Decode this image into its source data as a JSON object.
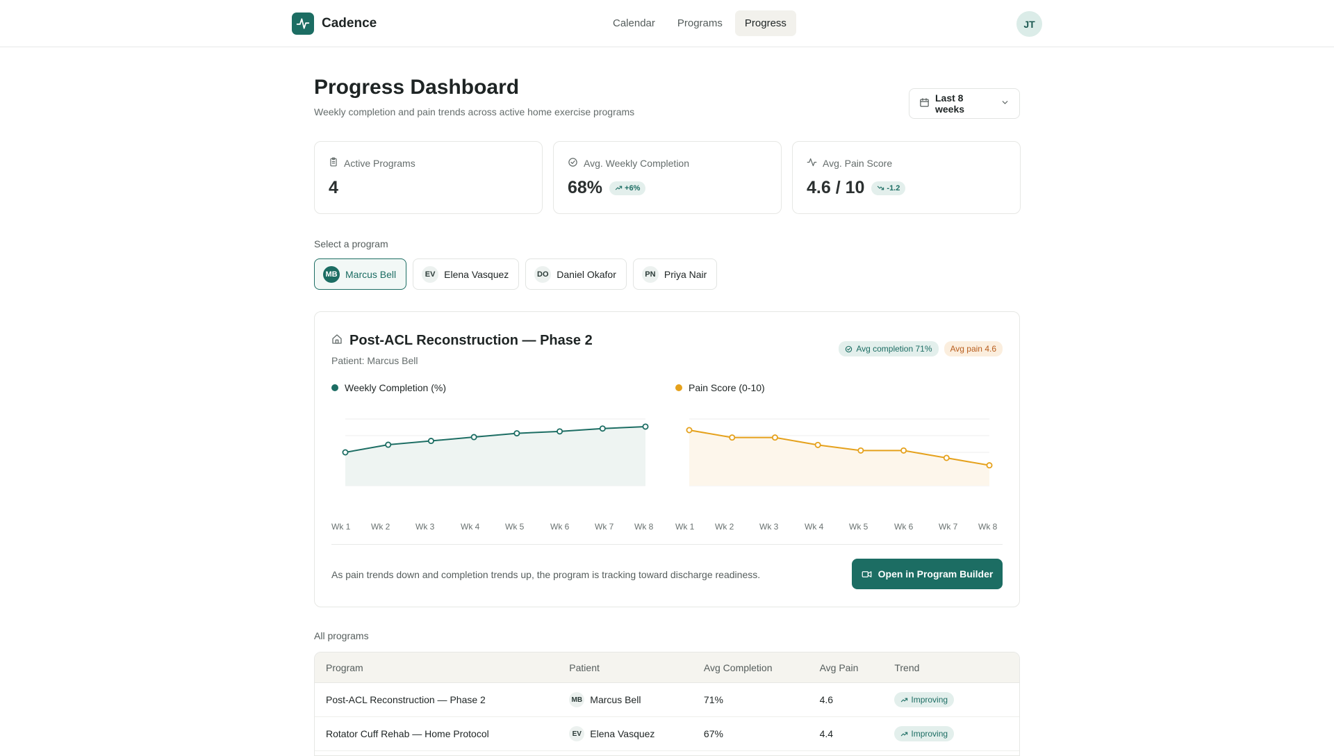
{
  "app": {
    "name": "Cadence",
    "user_initials": "JT"
  },
  "nav": {
    "items": [
      {
        "label": "Calendar"
      },
      {
        "label": "Programs"
      },
      {
        "label": "Progress"
      }
    ],
    "active_index": 2
  },
  "header": {
    "title": "Progress Dashboard",
    "subtitle": "Weekly completion and pain trends across active home exercise programs",
    "range": "Last 8 weeks"
  },
  "stats": [
    {
      "label": "Active Programs",
      "value": "4",
      "icon": "clipboard-icon"
    },
    {
      "label": "Avg. Weekly Completion",
      "value": "68%",
      "delta": "+6%",
      "icon": "check-circle-icon"
    },
    {
      "label": "Avg. Pain Score",
      "value": "4.6 / 10",
      "delta": "-1.2",
      "icon": "activity-icon"
    }
  ],
  "selector": {
    "label": "Select a program",
    "programs": [
      {
        "initials": "MB",
        "name": "Marcus Bell"
      },
      {
        "initials": "EV",
        "name": "Elena Vasquez"
      },
      {
        "initials": "DO",
        "name": "Daniel Okafor"
      },
      {
        "initials": "PN",
        "name": "Priya Nair"
      }
    ],
    "active_index": 0
  },
  "detail": {
    "title": "Post-ACL Reconstruction — Phase 2",
    "patient": "Patient: Marcus Bell",
    "avg_completion_pill": "Avg completion 71%",
    "avg_pain_pill": "Avg pain 4.6",
    "insight": "As pain trends down and completion trends up, the program is tracking toward discharge readiness.",
    "button": "Open in Program Builder"
  },
  "colors": {
    "accent": "#1c6d63",
    "pain": "#e5a11c"
  },
  "chart_data": [
    {
      "type": "area",
      "title": "Weekly Completion (%)",
      "categories": [
        "Wk 1",
        "Wk 2",
        "Wk 3",
        "Wk 4",
        "Wk 5",
        "Wk 6",
        "Wk 7",
        "Wk 8"
      ],
      "values": [
        55,
        63,
        67,
        71,
        75,
        77,
        80,
        82
      ],
      "ylim": [
        0,
        100
      ],
      "color": "#1c6d63",
      "grid": true
    },
    {
      "type": "area",
      "title": "Pain Score (0-10)",
      "categories": [
        "Wk 1",
        "Wk 2",
        "Wk 3",
        "Wk 4",
        "Wk 5",
        "Wk 6",
        "Wk 7",
        "Wk 8"
      ],
      "values": [
        5.9,
        5.5,
        5.5,
        5.1,
        4.8,
        4.8,
        4.4,
        4.0
      ],
      "ylim": [
        0,
        10
      ],
      "color": "#e5a11c",
      "grid": true
    }
  ],
  "table": {
    "section_label": "All programs",
    "columns": [
      "Program",
      "Patient",
      "Avg Completion",
      "Avg Pain",
      "Trend"
    ],
    "rows": [
      {
        "program": "Post-ACL Reconstruction — Phase 2",
        "initials": "MB",
        "patient": "Marcus Bell",
        "completion": "71%",
        "pain": "4.6",
        "trend": "Improving"
      },
      {
        "program": "Rotator Cuff Rehab — Home Protocol",
        "initials": "EV",
        "patient": "Elena Vasquez",
        "completion": "67%",
        "pain": "4.4",
        "trend": "Improving"
      }
    ]
  }
}
